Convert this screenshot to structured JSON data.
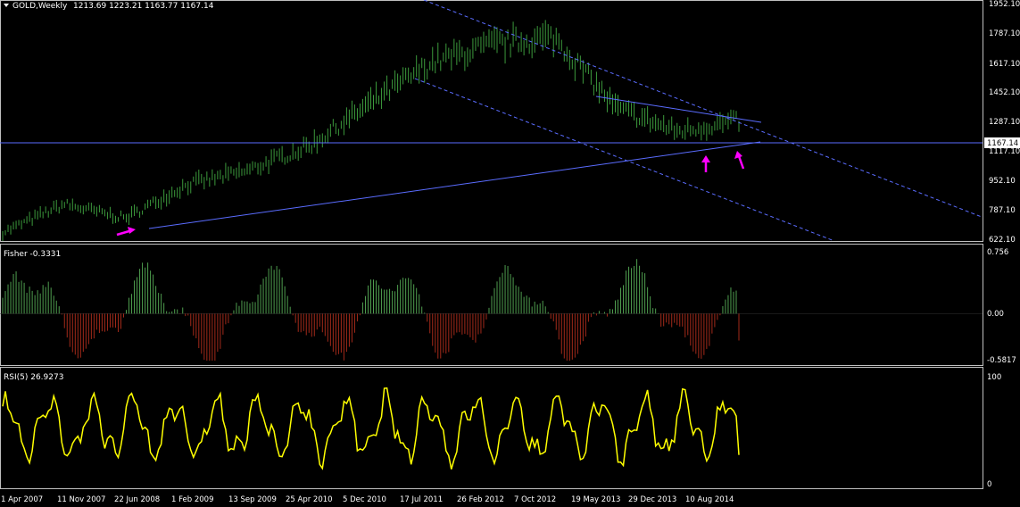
{
  "main": {
    "symbol_label": "GOLD,Weekly",
    "ohlc": "1213.69 1223.21 1163.77 1167.14",
    "price_ticks": [
      "1952.10",
      "1787.10",
      "1617.10",
      "1452.10",
      "1287.10",
      "1117.10",
      "952.10",
      "787.10",
      "622.10"
    ],
    "current_price_label": "1167.14"
  },
  "fisher": {
    "label": "Fisher -0.3331",
    "ticks": [
      "0.756",
      "0.00",
      "-0.5817"
    ]
  },
  "rsi": {
    "label": "RSI(5) 26.9273",
    "ticks": [
      "100",
      "0"
    ]
  },
  "time_axis": [
    "1 Apr 2007",
    "11 Nov 2007",
    "22 Jun 2008",
    "1 Feb 2009",
    "13 Sep 2009",
    "25 Apr 2010",
    "5 Dec 2010",
    "17 Jul 2011",
    "26 Feb 2012",
    "7 Oct 2012",
    "19 May 2013",
    "29 Dec 2013",
    "10 Aug 2014"
  ],
  "colors": {
    "background": "#000000",
    "candles": "#3c9a3c",
    "fisher_positive": "#4f9e4f",
    "fisher_negative": "#a32a1a",
    "rsi_line": "#ffff00",
    "trendlines": "#5a6cff",
    "arrows": "#ff00ff",
    "axis_text": "#ffffff",
    "panel_border": "#c0c0c0"
  },
  "chart_data": [
    {
      "type": "line",
      "title": "GOLD,Weekly",
      "ylim": [
        622.1,
        1952.1
      ],
      "x": [
        "1 Apr 2007",
        "11 Nov 2007",
        "22 Jun 2008",
        "1 Feb 2009",
        "13 Sep 2009",
        "25 Apr 2010",
        "5 Dec 2010",
        "17 Jul 2011",
        "26 Feb 2012",
        "7 Oct 2012",
        "19 May 2013",
        "29 Dec 2013",
        "10 Aug 2014"
      ],
      "series": [
        {
          "values": [
            660,
            820,
            740,
            930,
            1010,
            1150,
            1390,
            1620,
            1720,
            1760,
            1360,
            1230,
            1290
          ]
        }
      ],
      "last_price": 1167.14
    },
    {
      "type": "bar",
      "title": "Fisher -0.3331",
      "ylim": [
        -0.5817,
        0.756
      ],
      "last_value": -0.3331
    },
    {
      "type": "line",
      "title": "RSI(5) 26.9273",
      "ylim": [
        0,
        100
      ],
      "last_value": 26.9273
    }
  ]
}
